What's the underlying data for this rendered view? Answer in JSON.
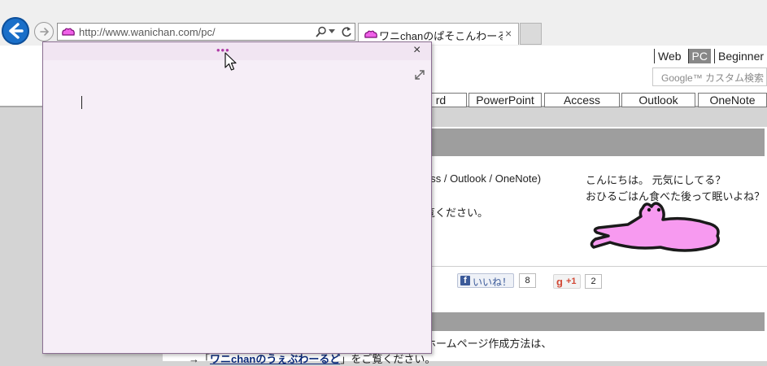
{
  "browser": {
    "address_url": "http://www.wanichan.com/pc/",
    "tab_title": "ワニchanのぱそこんわーるど：...",
    "tab_close": "×"
  },
  "site": {
    "header_links": [
      "Web",
      "PC",
      "Beginner"
    ],
    "search_placeholder": "Google™ カスタム検索",
    "nav_tabs": [
      "rd",
      "PowerPoint",
      "Access",
      "Outlook",
      "OneNote"
    ],
    "intro_line_1": "ccess / Outlook / OneNote)",
    "intro_line_2": "ご覧ください。",
    "greeting_line_1": "こんにちは。 元気にしてる？",
    "greeting_line_2": "おひるごはん食べた後って眠いよね？",
    "like_label": "いいね！",
    "like_count": "8",
    "gplus_label": "+1",
    "gplus_count": "2",
    "section2_line_1": "たホームページ作成方法は、",
    "section2_line_2_prefix": "→「",
    "section2_link": "ワニchanのうぇぶわーるど",
    "section2_line_2_suffix": "」をご覧ください。"
  },
  "sticky_note": {
    "drag_dots": "•••",
    "close": "×"
  },
  "colors": {
    "note_background": "#f6eef7",
    "note_accent": "#b03aa6",
    "back_button": "#1a6fc9",
    "section_header": "#9e9e9e",
    "gator_pink": "#f79af0"
  },
  "icons": [
    "back-arrow-icon",
    "forward-arrow-icon",
    "favicon-icon",
    "search-icon",
    "dropdown-icon",
    "refresh-icon",
    "close-icon",
    "expand-icon",
    "facebook-icon",
    "google-plus-icon",
    "mouse-cursor-icon"
  ]
}
